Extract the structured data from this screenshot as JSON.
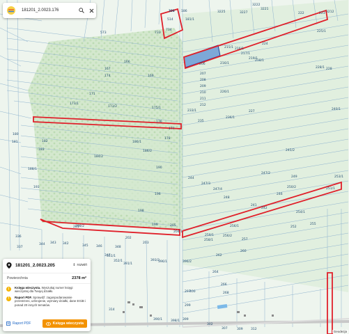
{
  "search": {
    "query": "181201_2.0023.176"
  },
  "panel": {
    "parcel_id": "181201_2.0023.205",
    "zoom_selector": "rozwiń",
    "area_label": "Powierzchnia",
    "area_value": "2378 m²",
    "items": [
      {
        "title": "Księga wieczysta.",
        "text": "Wyszukaj numer księgi wieczystej dla Twojej działki."
      },
      {
        "title": "Raport PDF.",
        "text": "Sprawdź: zagospodarowanie przestrzeni, uzbrojenie, wymiary działki, dane EGiB i ponad 20 innych tematów."
      }
    ],
    "btn_pdf": "Raport PDF",
    "btn_kw": "Księga wieczysta"
  },
  "map": {
    "parcel_labels": [
      {
        "t": "190"
      },
      {
        "t": "186"
      },
      {
        "t": "514"
      },
      {
        "t": "181/1"
      },
      {
        "t": "3225"
      },
      {
        "t": "3227"
      },
      {
        "t": "3222"
      },
      {
        "t": "3221"
      },
      {
        "t": "222"
      },
      {
        "t": "223"
      },
      {
        "t": "3212"
      },
      {
        "t": "225/1"
      },
      {
        "t": "734"
      },
      {
        "t": "733"
      },
      {
        "t": "573"
      },
      {
        "t": "215/1"
      },
      {
        "t": "224"
      },
      {
        "t": "216/1"
      },
      {
        "t": "217/1"
      },
      {
        "t": "218/1"
      },
      {
        "t": "219/1"
      },
      {
        "t": "206"
      },
      {
        "t": "207"
      },
      {
        "t": "208"
      },
      {
        "t": "209"
      },
      {
        "t": "210"
      },
      {
        "t": "211"
      },
      {
        "t": "212"
      },
      {
        "t": "216/1"
      },
      {
        "t": "226/1"
      },
      {
        "t": "228/1"
      },
      {
        "t": "228"
      },
      {
        "t": "227"
      },
      {
        "t": "235"
      },
      {
        "t": "233/1"
      },
      {
        "t": "236/1"
      },
      {
        "t": "240/1"
      },
      {
        "t": "173/1"
      },
      {
        "t": "173/2"
      },
      {
        "t": "175/1"
      },
      {
        "t": "174"
      },
      {
        "t": "171"
      },
      {
        "t": "167"
      },
      {
        "t": "166"
      },
      {
        "t": "169"
      },
      {
        "t": "176"
      },
      {
        "t": "177"
      },
      {
        "t": "178"
      },
      {
        "t": "180"
      },
      {
        "t": "181"
      },
      {
        "t": "182"
      },
      {
        "t": "183"
      },
      {
        "t": "184/2"
      },
      {
        "t": "186/1"
      },
      {
        "t": "186/2"
      },
      {
        "t": "188/1"
      },
      {
        "t": "190"
      },
      {
        "t": "193"
      },
      {
        "t": "196"
      },
      {
        "t": "198"
      },
      {
        "t": "199"
      },
      {
        "t": "245/2"
      },
      {
        "t": "247/2"
      },
      {
        "t": "249"
      },
      {
        "t": "250/2"
      },
      {
        "t": "251/1"
      },
      {
        "t": "253/1"
      },
      {
        "t": "244"
      },
      {
        "t": "247/4"
      },
      {
        "t": "247/3"
      },
      {
        "t": "248"
      },
      {
        "t": "241"
      },
      {
        "t": "242"
      },
      {
        "t": "246"
      },
      {
        "t": "252"
      },
      {
        "t": "254/1"
      },
      {
        "t": "255"
      },
      {
        "t": "256/1"
      },
      {
        "t": "256/2"
      },
      {
        "t": "257"
      },
      {
        "t": "258/1"
      },
      {
        "t": "259/1"
      },
      {
        "t": "260"
      },
      {
        "t": "262"
      },
      {
        "t": "264"
      },
      {
        "t": "266"
      },
      {
        "t": "268"
      },
      {
        "t": "201"
      },
      {
        "t": "202"
      },
      {
        "t": "203"
      },
      {
        "t": "204/1"
      },
      {
        "t": "205"
      },
      {
        "t": "343"
      },
      {
        "t": "342"
      },
      {
        "t": "344"
      },
      {
        "t": "345"
      },
      {
        "t": "346"
      },
      {
        "t": "348"
      },
      {
        "t": "336"
      },
      {
        "t": "337"
      },
      {
        "t": "347"
      },
      {
        "t": "351/1"
      },
      {
        "t": "352/1"
      },
      {
        "t": "391/1"
      },
      {
        "t": "393/2"
      },
      {
        "t": "396/1"
      },
      {
        "t": "396/2"
      },
      {
        "t": "297"
      },
      {
        "t": "299"
      },
      {
        "t": "302"
      },
      {
        "t": "307"
      },
      {
        "t": "309"
      },
      {
        "t": "312"
      },
      {
        "t": "314"
      },
      {
        "t": "390/1"
      },
      {
        "t": "398/1"
      },
      {
        "t": "399"
      },
      {
        "t": "400"
      },
      {
        "t": "398/2"
      },
      {
        "t": "301"
      }
    ]
  },
  "attribution": "Geodezja"
}
